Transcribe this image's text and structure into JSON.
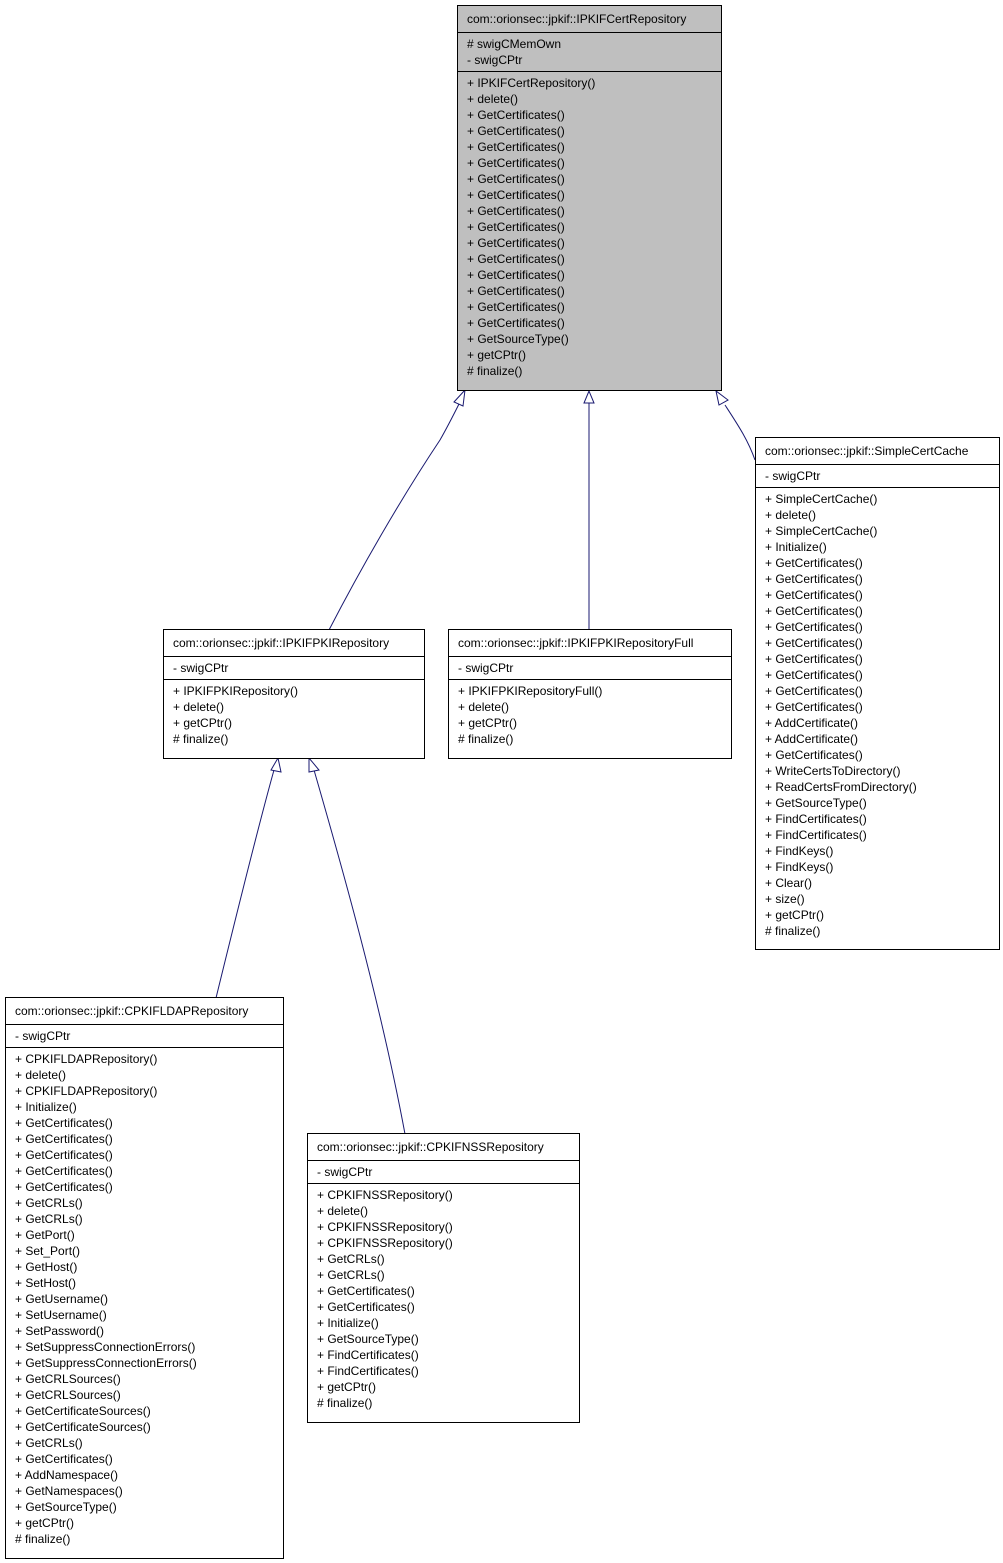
{
  "diagram": {
    "type": "class-inheritance",
    "colors": {
      "edge": "#191970",
      "focus_fill": "#bfbfbf",
      "border": "#000000"
    },
    "classes": {
      "cert_repo": {
        "name": "com::orionsec::jpkif::IPKIFCertRepository",
        "attributes": [
          "# swigCMemOwn",
          "- swigCPtr"
        ],
        "operations": [
          "+ IPKIFCertRepository()",
          "+ delete()",
          "+ GetCertificates()",
          "+ GetCertificates()",
          "+ GetCertificates()",
          "+ GetCertificates()",
          "+ GetCertificates()",
          "+ GetCertificates()",
          "+ GetCertificates()",
          "+ GetCertificates()",
          "+ GetCertificates()",
          "+ GetCertificates()",
          "+ GetCertificates()",
          "+ GetCertificates()",
          "+ GetCertificates()",
          "+ GetCertificates()",
          "+ GetSourceType()",
          "+ getCPtr()",
          "# finalize()"
        ]
      },
      "simple_cache": {
        "name": "com::orionsec::jpkif::SimpleCertCache",
        "attributes": [
          "- swigCPtr"
        ],
        "operations": [
          "+ SimpleCertCache()",
          "+ delete()",
          "+ SimpleCertCache()",
          "+ Initialize()",
          "+ GetCertificates()",
          "+ GetCertificates()",
          "+ GetCertificates()",
          "+ GetCertificates()",
          "+ GetCertificates()",
          "+ GetCertificates()",
          "+ GetCertificates()",
          "+ GetCertificates()",
          "+ GetCertificates()",
          "+ GetCertificates()",
          "+ AddCertificate()",
          "+ AddCertificate()",
          "+ GetCertificates()",
          "+ WriteCertsToDirectory()",
          "+ ReadCertsFromDirectory()",
          "+ GetSourceType()",
          "+ FindCertificates()",
          "+ FindCertificates()",
          "+ FindKeys()",
          "+ FindKeys()",
          "+ Clear()",
          "+ size()",
          "+ getCPtr()",
          "# finalize()"
        ]
      },
      "pki_repo": {
        "name": "com::orionsec::jpkif::IPKIFPKIRepository",
        "attributes": [
          "- swigCPtr"
        ],
        "operations": [
          "+ IPKIFPKIRepository()",
          "+ delete()",
          "+ getCPtr()",
          "# finalize()"
        ]
      },
      "pki_repo_full": {
        "name": "com::orionsec::jpkif::IPKIFPKIRepositoryFull",
        "attributes": [
          "- swigCPtr"
        ],
        "operations": [
          "+ IPKIFPKIRepositoryFull()",
          "+ delete()",
          "+ getCPtr()",
          "# finalize()"
        ]
      },
      "ldap_repo": {
        "name": "com::orionsec::jpkif::CPKIFLDAPRepository",
        "attributes": [
          "- swigCPtr"
        ],
        "operations": [
          "+ CPKIFLDAPRepository()",
          "+ delete()",
          "+ CPKIFLDAPRepository()",
          "+ Initialize()",
          "+ GetCertificates()",
          "+ GetCertificates()",
          "+ GetCertificates()",
          "+ GetCertificates()",
          "+ GetCertificates()",
          "+ GetCRLs()",
          "+ GetCRLs()",
          "+ GetPort()",
          "+ Set_Port()",
          "+ GetHost()",
          "+ SetHost()",
          "+ GetUsername()",
          "+ SetUsername()",
          "+ SetPassword()",
          "+ SetSuppressConnectionErrors()",
          "+ GetSuppressConnectionErrors()",
          "+ GetCRLSources()",
          "+ GetCRLSources()",
          "+ GetCertificateSources()",
          "+ GetCertificateSources()",
          "+ GetCRLs()",
          "+ GetCertificates()",
          "+ AddNamespace()",
          "+ GetNamespaces()",
          "+ GetSourceType()",
          "+ getCPtr()",
          "# finalize()"
        ]
      },
      "nss_repo": {
        "name": "com::orionsec::jpkif::CPKIFNSSRepository",
        "attributes": [
          "- swigCPtr"
        ],
        "operations": [
          "+ CPKIFNSSRepository()",
          "+ delete()",
          "+ CPKIFNSSRepository()",
          "+ CPKIFNSSRepository()",
          "+ GetCRLs()",
          "+ GetCRLs()",
          "+ GetCertificates()",
          "+ GetCertificates()",
          "+ Initialize()",
          "+ GetSourceType()",
          "+ FindCertificates()",
          "+ FindCertificates()",
          "+ getCPtr()",
          "# finalize()"
        ]
      }
    },
    "inheritance": [
      {
        "child": "pki_repo",
        "parent": "cert_repo"
      },
      {
        "child": "pki_repo_full",
        "parent": "cert_repo"
      },
      {
        "child": "simple_cache",
        "parent": "cert_repo"
      },
      {
        "child": "ldap_repo",
        "parent": "pki_repo"
      },
      {
        "child": "nss_repo",
        "parent": "pki_repo"
      }
    ]
  }
}
